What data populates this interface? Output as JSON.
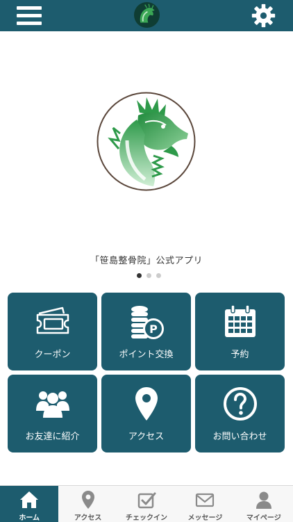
{
  "header": {
    "menu_icon": "hamburger-menu-icon",
    "settings_icon": "gear-icon",
    "logo": "dragon-logo"
  },
  "colors": {
    "primary": "#1d5c6e",
    "logo_green": "#2e9a4a",
    "logo_ring": "#5a463a"
  },
  "hero": {
    "caption": "「笹島整骨院」公式アプリ",
    "slide_count": 3,
    "active_slide": 1
  },
  "tiles": [
    {
      "label": "クーポン",
      "icon": "ticket-icon"
    },
    {
      "label": "ポイント交換",
      "icon": "coins-points-icon"
    },
    {
      "label": "予約",
      "icon": "calendar-icon"
    },
    {
      "label": "お友達に紹介",
      "icon": "people-group-icon"
    },
    {
      "label": "アクセス",
      "icon": "map-pin-icon"
    },
    {
      "label": "お問い合わせ",
      "icon": "question-circle-icon"
    }
  ],
  "tabs": [
    {
      "label": "ホーム",
      "icon": "home-icon",
      "active": true
    },
    {
      "label": "アクセス",
      "icon": "map-pin-icon"
    },
    {
      "label": "チェックイン",
      "icon": "checkin-icon"
    },
    {
      "label": "メッセージ",
      "icon": "envelope-icon"
    },
    {
      "label": "マイページ",
      "icon": "person-icon"
    }
  ]
}
